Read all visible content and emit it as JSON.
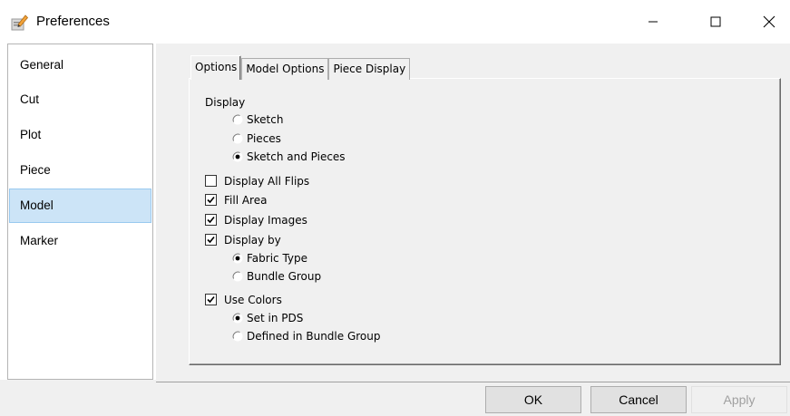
{
  "window": {
    "title": "Preferences",
    "icon": "preferences-pencil-icon"
  },
  "sidebar": {
    "items": [
      {
        "label": "General",
        "selected": false
      },
      {
        "label": "Cut",
        "selected": false
      },
      {
        "label": "Plot",
        "selected": false
      },
      {
        "label": "Piece",
        "selected": false
      },
      {
        "label": "Model",
        "selected": true
      },
      {
        "label": "Marker",
        "selected": false
      }
    ]
  },
  "tabs": [
    {
      "label": "Options",
      "active": true
    },
    {
      "label": "Model Options",
      "active": false
    },
    {
      "label": "Piece Display",
      "active": false
    }
  ],
  "options": {
    "display_label": "Display",
    "display_radios": [
      {
        "label": "Sketch",
        "checked": false
      },
      {
        "label": "Pieces",
        "checked": false
      },
      {
        "label": "Sketch and Pieces",
        "checked": true
      }
    ],
    "display_all_flips": {
      "label": "Display All Flips",
      "checked": false
    },
    "fill_area": {
      "label": "Fill Area",
      "checked": true
    },
    "display_images": {
      "label": "Display Images",
      "checked": true
    },
    "display_by": {
      "label": "Display by",
      "checked": true
    },
    "display_by_radios": [
      {
        "label": "Fabric Type",
        "checked": true
      },
      {
        "label": "Bundle Group",
        "checked": false
      }
    ],
    "use_colors": {
      "label": "Use Colors",
      "checked": true
    },
    "use_colors_radios": [
      {
        "label": "Set in PDS",
        "checked": true
      },
      {
        "label": "Defined in Bundle Group",
        "checked": false
      }
    ]
  },
  "buttons": {
    "ok": "OK",
    "cancel": "Cancel",
    "apply": "Apply"
  }
}
